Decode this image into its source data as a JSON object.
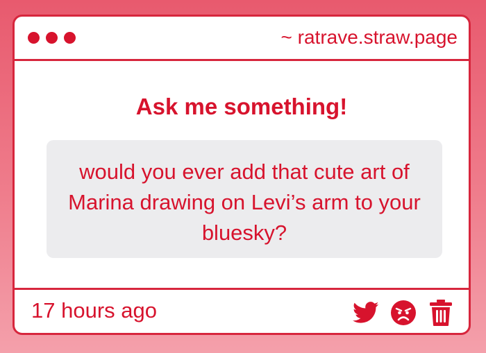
{
  "window": {
    "url": "~ ratrave.straw.page"
  },
  "main": {
    "heading": "Ask me something!",
    "question": "would you ever add that cute art of Marina drawing on Levi’s arm to your bluesky?"
  },
  "footer": {
    "timestamp": "17 hours ago",
    "actions": [
      {
        "icon": "twitter-icon"
      },
      {
        "icon": "angry-face-icon"
      },
      {
        "icon": "trash-icon"
      }
    ]
  },
  "colors": {
    "accent": "#d7132d",
    "border": "#d7263d",
    "question_bg": "#ececee",
    "background_top": "#e85a6e",
    "background_bottom": "#f4a0ab"
  }
}
